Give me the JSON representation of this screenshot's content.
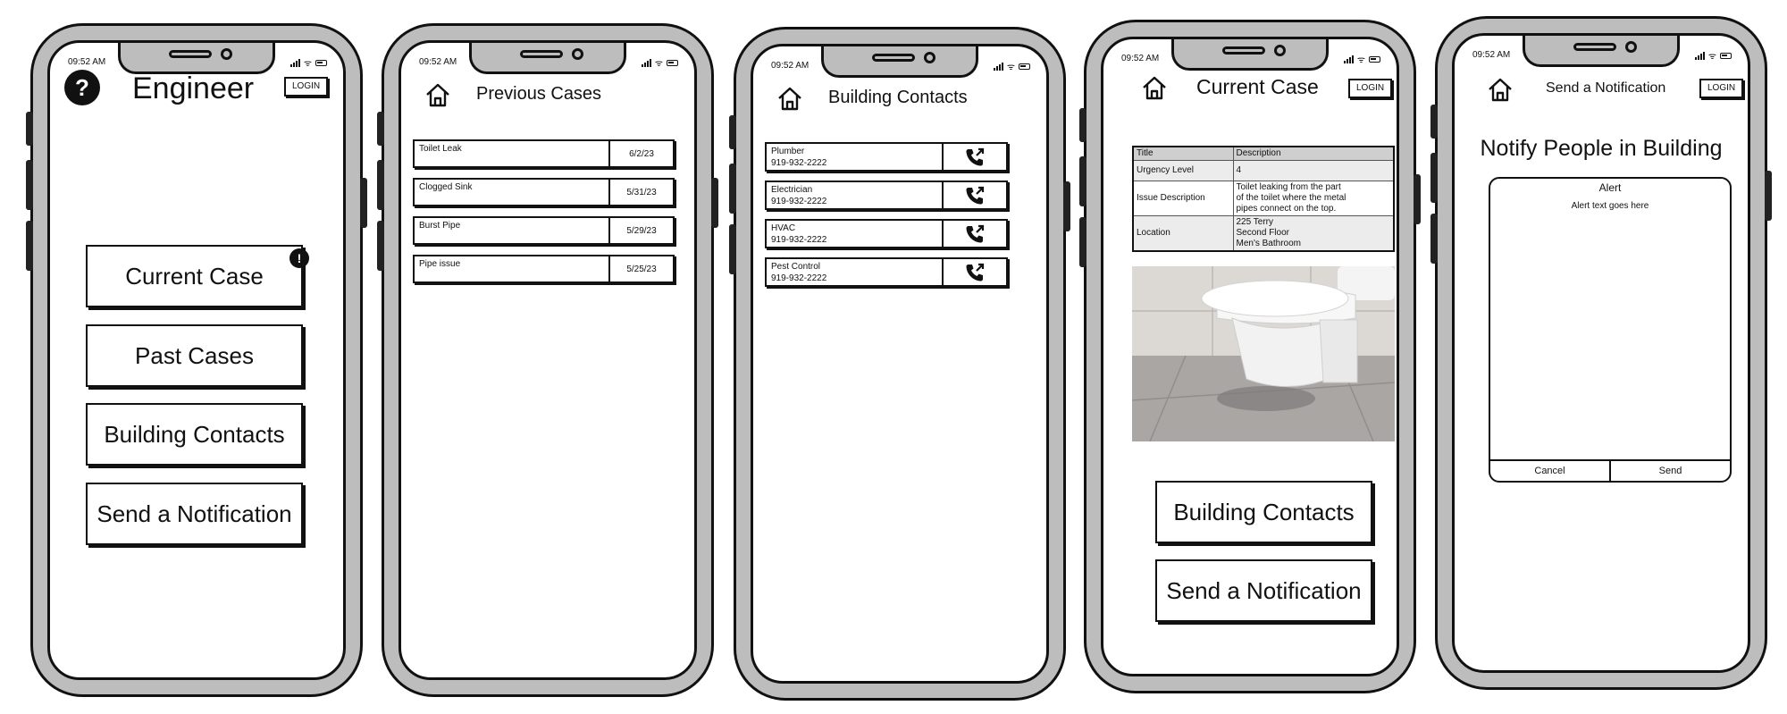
{
  "status": {
    "time": "09:52 AM"
  },
  "screens": {
    "main": {
      "help_glyph": "?",
      "title": "Engineer",
      "login": "LOGIN",
      "badge_glyph": "!",
      "buttons": [
        "Current Case",
        "Past Cases",
        "Building Contacts",
        "Send a Notification"
      ]
    },
    "previous": {
      "title": "Previous Cases",
      "cases": [
        {
          "title": "Toilet Leak",
          "date": "6/2/23"
        },
        {
          "title": "Clogged Sink",
          "date": "5/31/23"
        },
        {
          "title": "Burst Pipe",
          "date": "5/29/23"
        },
        {
          "title": "Pipe issue",
          "date": "5/25/23"
        }
      ]
    },
    "contacts": {
      "title": "Building Contacts",
      "items": [
        {
          "name": "Plumber",
          "phone": "919-932-2222"
        },
        {
          "name": "Electrician",
          "phone": "919-932-2222"
        },
        {
          "name": "HVAC",
          "phone": "919-932-2222"
        },
        {
          "name": "Pest Control",
          "phone": "919-932-2222"
        }
      ]
    },
    "current": {
      "title": "Current Case",
      "login": "LOGIN",
      "table": {
        "header": [
          "Title",
          "Description"
        ],
        "rows": [
          {
            "key": "Urgency Level",
            "lines": [
              "4"
            ]
          },
          {
            "key": "Issue Description",
            "lines": [
              "Toilet leaking from the part",
              "of the toilet where the metal",
              "pipes connect on the top."
            ]
          },
          {
            "key": "Location",
            "lines": [
              "225 Terry",
              "Second Floor",
              "Men's Bathroom"
            ]
          }
        ]
      },
      "buttons": [
        "Building Contacts",
        "Send a Notification"
      ]
    },
    "notify": {
      "title": "Send a Notification",
      "login": "LOGIN",
      "heading": "Notify People in Building",
      "alert_title": "Alert",
      "alert_text": "Alert text goes here",
      "cancel": "Cancel",
      "send": "Send"
    }
  },
  "icons": {
    "help": "help-circle-icon",
    "home": "home-icon",
    "call": "phone-call-icon",
    "alert": "exclamation-badge-icon"
  },
  "colors": {
    "frame": "#bdbdbd",
    "ink": "#111111",
    "table_header": "#cfcfcf"
  }
}
